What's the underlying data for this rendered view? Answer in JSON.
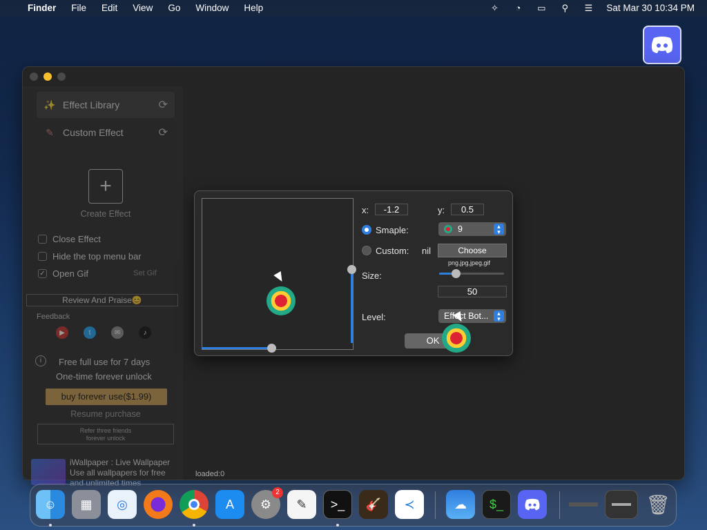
{
  "menubar": {
    "app": "Finder",
    "items": [
      "File",
      "Edit",
      "View",
      "Go",
      "Window",
      "Help"
    ],
    "datetime": "Sat Mar 30  10:34 PM"
  },
  "sidebar": {
    "effect_library": "Effect Library",
    "custom_effect": "Custom Effect",
    "create_effect": "Create Effect",
    "close_effect": "Close Effect",
    "hide_menu_bar": "Hide the top menu bar",
    "open_gif": "Open Gif",
    "set_gif": "Set Gif",
    "review": "Review And Praise😊",
    "feedback": "Feedback",
    "trial_line1": "Free full use for 7 days",
    "trial_line2": "One-time forever unlock",
    "buy": "buy forever use($1.99)",
    "resume": "Resume purchase",
    "refer_line1": "Refer three friends",
    "refer_line2": "forever unlock",
    "promo_title": "iWallpaper : Live Wallpaper",
    "promo_line2": "Use all wallpapers for free",
    "promo_line3": "and unlimited times"
  },
  "status": {
    "loaded": "loaded:0"
  },
  "dialog": {
    "x_label": "x:",
    "x_value": "-1.2",
    "y_label": "y:",
    "y_value": "0.5",
    "sample_label": "Smaple:",
    "sample_value": "9",
    "custom_label": "Custom:",
    "custom_value": "nil",
    "choose": "Choose",
    "formats": "png,jpg,jpeg,gif",
    "size_label": "Size:",
    "size_value": "50",
    "size_fraction": 0.25,
    "level_label": "Level:",
    "level_value": "Effect Bot...",
    "ok": "OK"
  },
  "dock": {
    "settings_badge": "2"
  },
  "colors": {
    "accent": "#2f7fe0",
    "buy_button": "#c29a4f",
    "discord": "#5865f2"
  }
}
